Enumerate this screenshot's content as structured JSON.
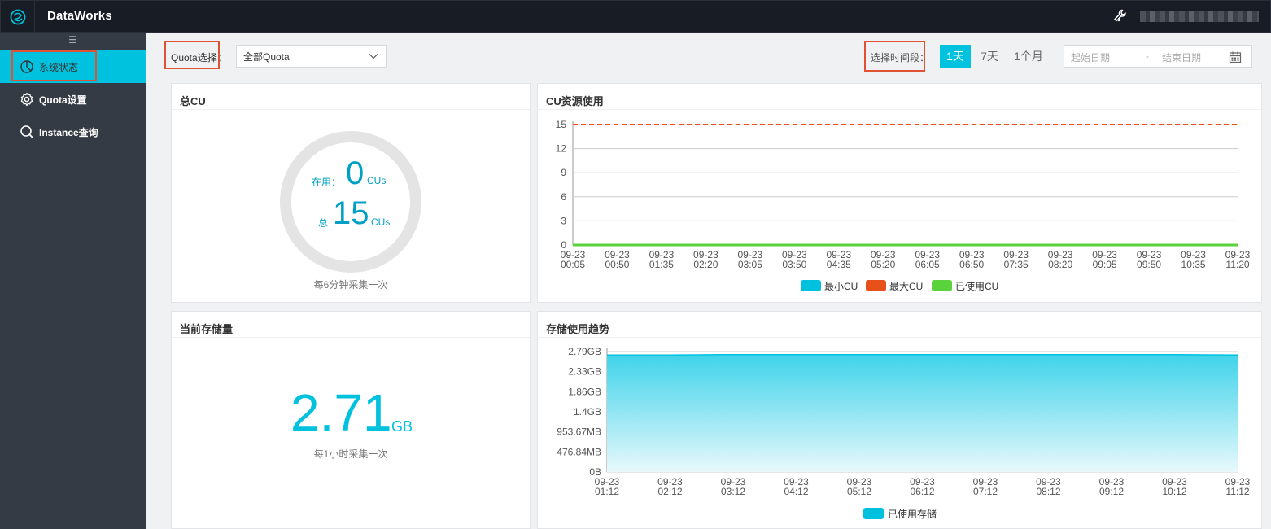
{
  "topbar": {
    "app_title": "DataWorks"
  },
  "sidebar": {
    "toggle_icon": "☰",
    "items": [
      {
        "label": "系统状态",
        "icon": "pie-chart-icon"
      },
      {
        "label": "Quota设置",
        "icon": "gear-icon"
      },
      {
        "label": "Instance查询",
        "icon": "search-icon"
      }
    ]
  },
  "filters": {
    "quota_label": "Quota选择：",
    "quota_selected": "全部Quota",
    "time_label": "选择时间段：",
    "time_options": [
      "1天",
      "7天",
      "1个月"
    ],
    "date_start_placeholder": "起始日期",
    "date_separator": "-",
    "date_end_placeholder": "结束日期"
  },
  "total_cu": {
    "title": "总CU",
    "in_use_label": "在用：",
    "in_use_value": "0",
    "unit_in_use": "CUs",
    "total_label": "总",
    "total_value": "15",
    "unit_total": "CUs",
    "note": "每6分钟采集一次"
  },
  "storage_current": {
    "title": "当前存储量",
    "value": "2.71",
    "unit": "GB",
    "note": "每1小时采集一次"
  },
  "colors": {
    "accent": "#00c1de",
    "max_cu": "#e8501a",
    "used_cu": "#5ad23c",
    "highlight": "#e15235"
  },
  "chart_data": [
    {
      "type": "line",
      "title": "CU资源使用",
      "x": [
        "09-23 00:05",
        "09-23 00:50",
        "09-23 01:35",
        "09-23 02:20",
        "09-23 03:05",
        "09-23 03:50",
        "09-23 04:35",
        "09-23 05:20",
        "09-23 06:05",
        "09-23 06:50",
        "09-23 07:35",
        "09-23 08:20",
        "09-23 09:05",
        "09-23 09:50",
        "09-23 10:35",
        "09-23 11:20"
      ],
      "yticks": [
        "0",
        "3",
        "6",
        "9",
        "12",
        "15"
      ],
      "ylim": [
        0,
        15
      ],
      "series": [
        {
          "name": "最小CU",
          "color": "#00c1de",
          "values": [
            0,
            0,
            0,
            0,
            0,
            0,
            0,
            0,
            0,
            0,
            0,
            0,
            0,
            0,
            0,
            0
          ]
        },
        {
          "name": "最大CU",
          "color": "#e8501a",
          "style": "dashed",
          "values": [
            15,
            15,
            15,
            15,
            15,
            15,
            15,
            15,
            15,
            15,
            15,
            15,
            15,
            15,
            15,
            15
          ]
        },
        {
          "name": "已使用CU",
          "color": "#5ad23c",
          "values": [
            0,
            0,
            0,
            0,
            0,
            0,
            0,
            0,
            0,
            0,
            0,
            0,
            0,
            0,
            0,
            0
          ]
        }
      ],
      "legend": "bottom"
    },
    {
      "type": "area",
      "title": "存储使用趋势",
      "x": [
        "09-23 01:12",
        "09-23 02:12",
        "09-23 03:12",
        "09-23 04:12",
        "09-23 05:12",
        "09-23 06:12",
        "09-23 07:12",
        "09-23 08:12",
        "09-23 09:12",
        "09-23 10:12",
        "09-23 11:12"
      ],
      "yticks": [
        "0B",
        "476.84MB",
        "953.67MB",
        "1.4GB",
        "1.86GB",
        "2.33GB",
        "2.79GB"
      ],
      "ylim": [
        0,
        2.79
      ],
      "series": [
        {
          "name": "已使用存储",
          "color": "#00c1de",
          "values": [
            2.71,
            2.71,
            2.72,
            2.72,
            2.72,
            2.72,
            2.72,
            2.72,
            2.72,
            2.72,
            2.71
          ]
        }
      ],
      "legend": "bottom"
    }
  ]
}
